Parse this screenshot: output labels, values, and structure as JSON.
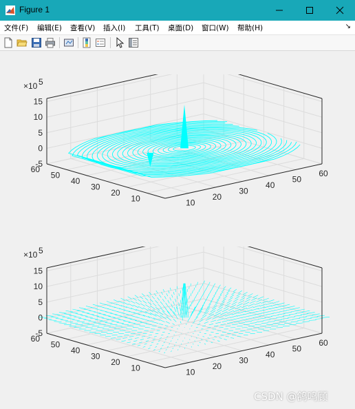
{
  "window": {
    "title": "Figure 1",
    "icon": "matlab-logo-icon"
  },
  "menu": [
    "文件(F)",
    "编辑(E)",
    "查看(V)",
    "插入(I)",
    "工具(T)",
    "桌面(D)",
    "窗口(W)",
    "帮助(H)"
  ],
  "menu_dock_glyph": "↘",
  "toolbar": [
    "new-figure-icon",
    "open-file-icon",
    "save-icon",
    "print-icon",
    "link-plot-icon",
    "insert-colorbar-icon",
    "insert-legend-icon",
    "pointer-icon",
    "property-inspector-icon"
  ],
  "colors": {
    "accent": "#18a8b8",
    "line": "#00ffff"
  },
  "chart_data": [
    {
      "type": "contour3",
      "title": "",
      "z_exponent": "×10",
      "z_exponent_power": "5",
      "z_ticks": [
        "15",
        "10",
        "5",
        "0",
        "-5"
      ],
      "zlim": [
        -500000,
        1600000
      ],
      "x_ticks": [
        "10",
        "20",
        "30",
        "40",
        "50",
        "60"
      ],
      "y_ticks": [
        "10",
        "20",
        "30",
        "40",
        "50",
        "60"
      ],
      "xlim": [
        1,
        60
      ],
      "ylim": [
        1,
        60
      ],
      "grid": true
    },
    {
      "type": "quiver3",
      "title": "",
      "z_exponent": "×10",
      "z_exponent_power": "5",
      "z_ticks": [
        "15",
        "10",
        "5",
        "0",
        "-5"
      ],
      "zlim": [
        -500000,
        1600000
      ],
      "x_ticks": [
        "10",
        "20",
        "30",
        "40",
        "50",
        "60"
      ],
      "y_ticks": [
        "10",
        "20",
        "30",
        "40",
        "50",
        "60"
      ],
      "xlim": [
        1,
        60
      ],
      "ylim": [
        1,
        60
      ],
      "grid": true
    }
  ],
  "watermark": "CSDN @鸽鸣顾"
}
